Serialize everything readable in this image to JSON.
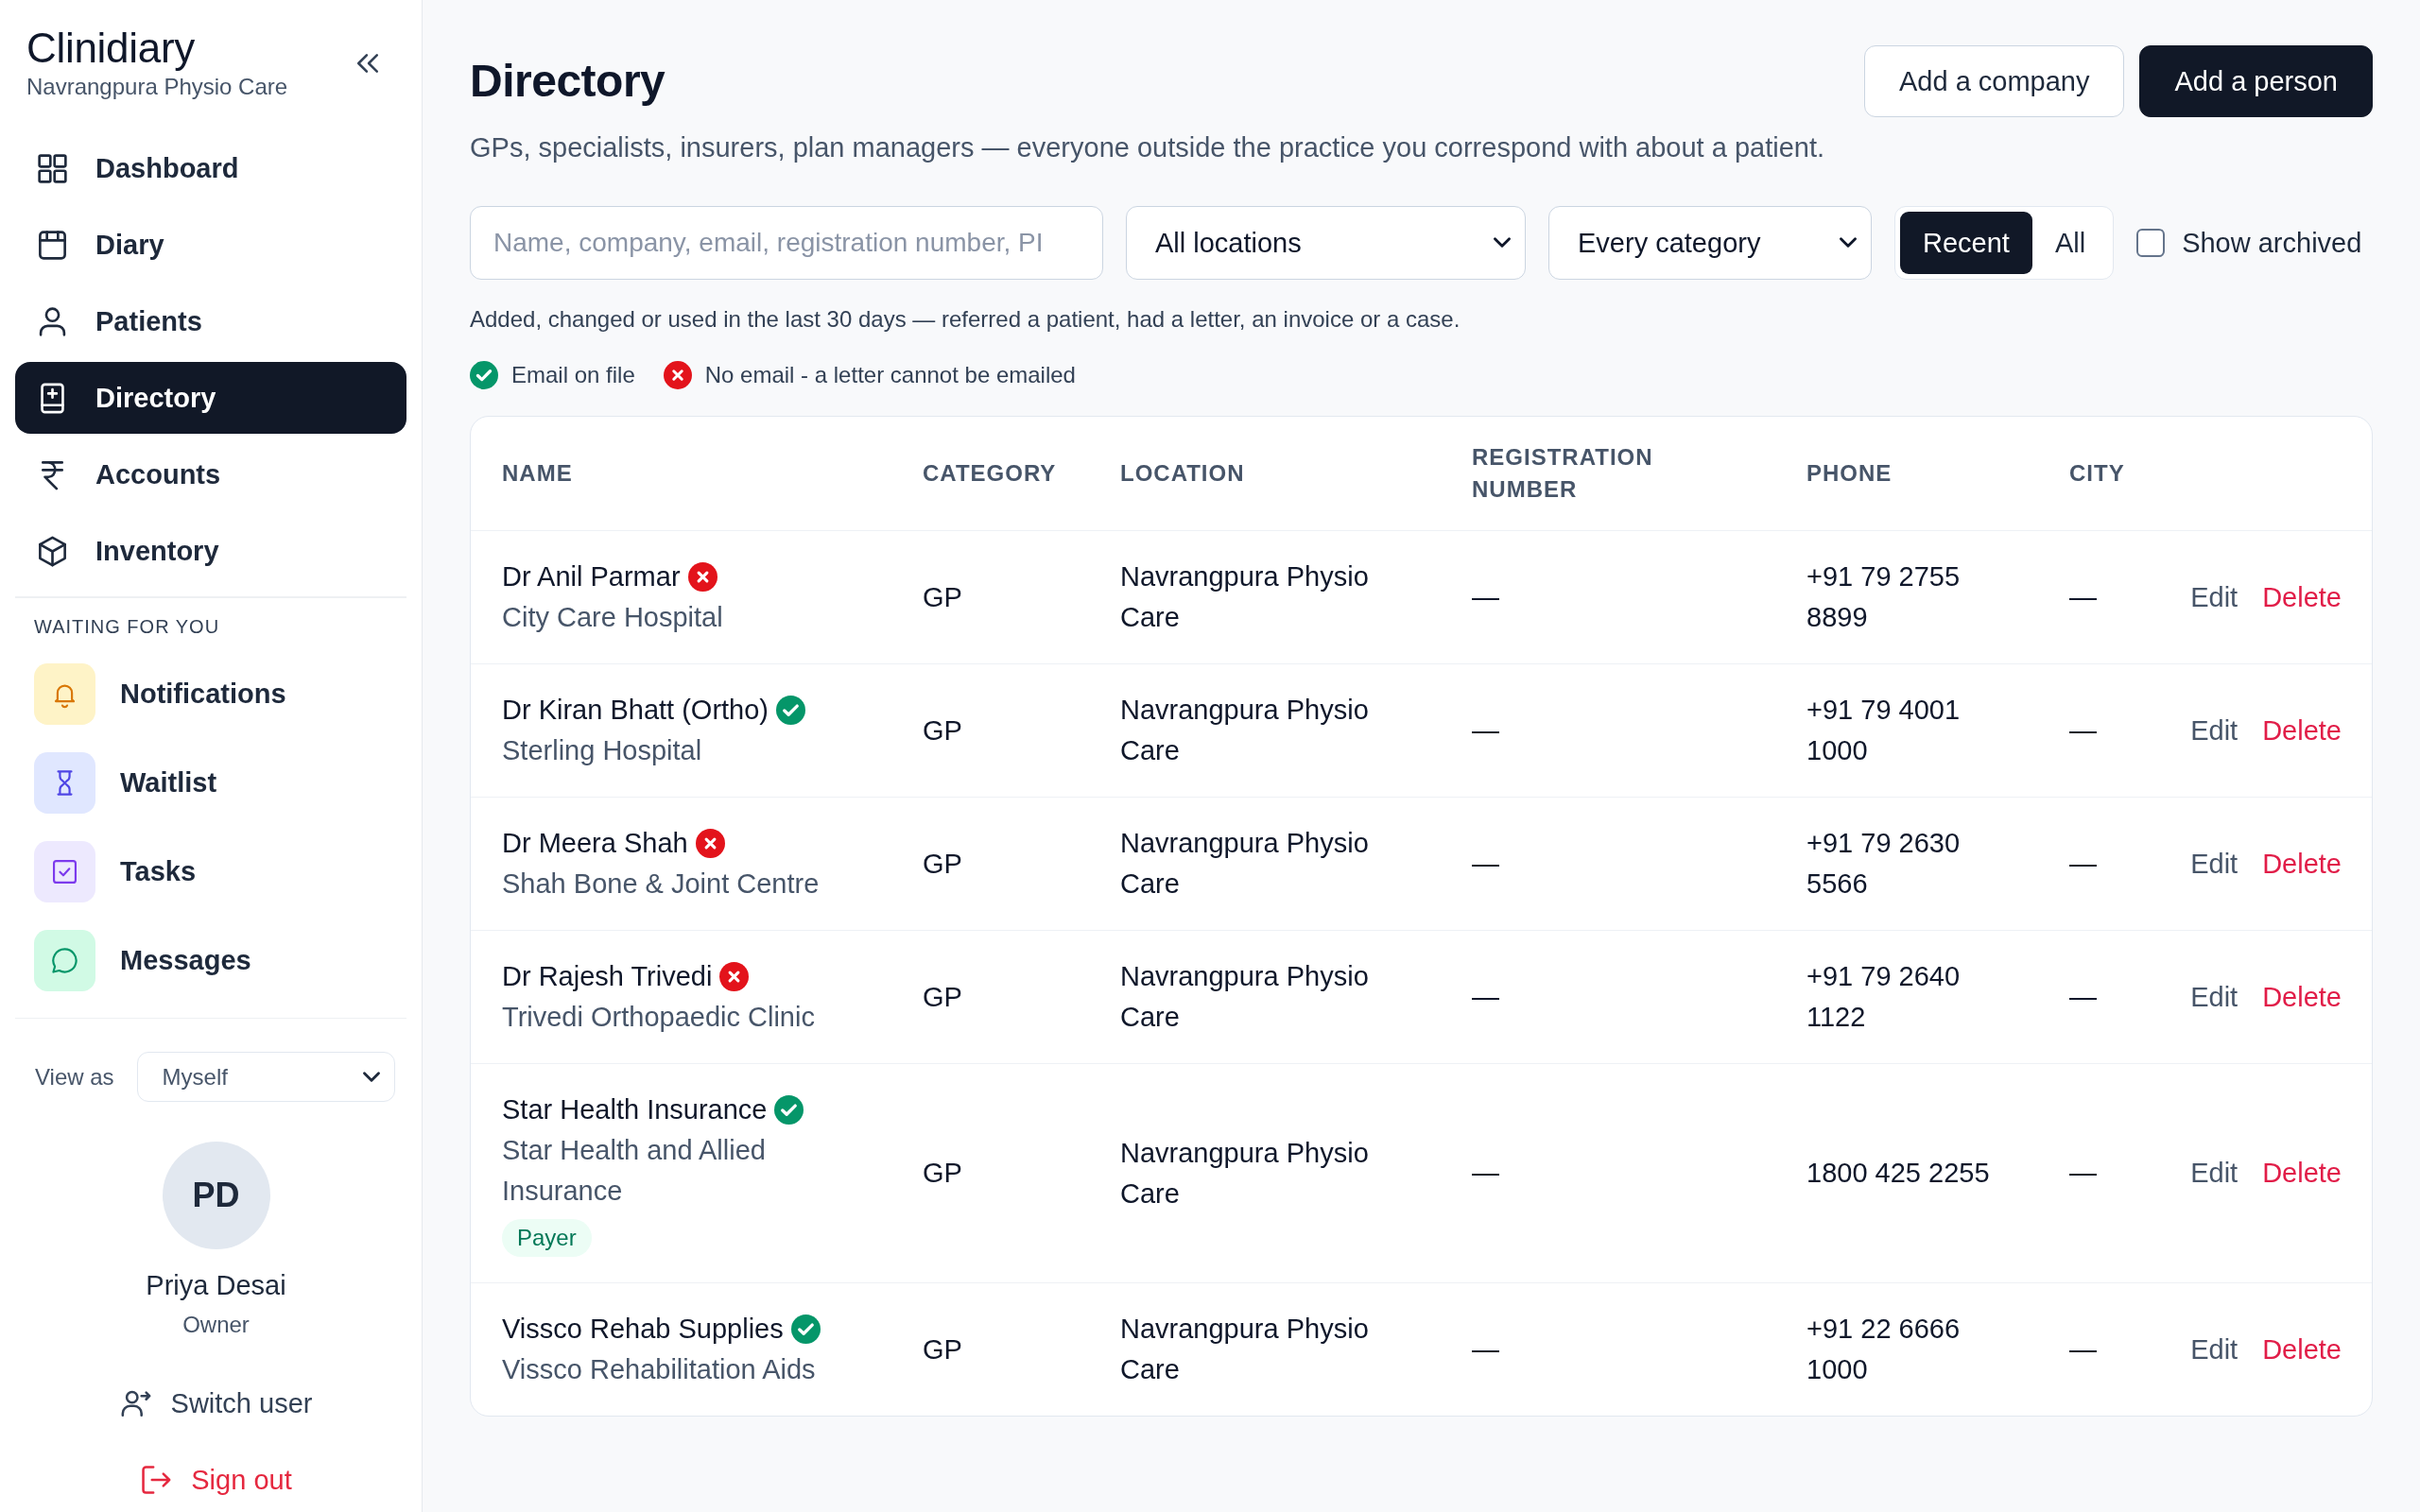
{
  "sidebar": {
    "brand": {
      "name": "Clinidiary",
      "practice": "Navrangpura Physio Care"
    },
    "nav": [
      {
        "label": "Dashboard",
        "selected": false
      },
      {
        "label": "Diary",
        "selected": false
      },
      {
        "label": "Patients",
        "selected": false
      },
      {
        "label": "Directory",
        "selected": true
      },
      {
        "label": "Accounts",
        "selected": false
      },
      {
        "label": "Inventory",
        "selected": false
      }
    ],
    "waiting": {
      "heading": "WAITING FOR YOU",
      "items": [
        {
          "label": "Notifications"
        },
        {
          "label": "Waitlist"
        },
        {
          "label": "Tasks"
        },
        {
          "label": "Messages"
        }
      ]
    },
    "view_as": {
      "label": "View as",
      "value": "Myself"
    },
    "user": {
      "initials": "PD",
      "name": "Priya Desai",
      "role": "Owner"
    },
    "actions": [
      {
        "label": "Switch user",
        "kind": "switch"
      },
      {
        "label": "Sign out",
        "kind": "signout"
      }
    ]
  },
  "page": {
    "title": "Directory",
    "description": "GPs, specialists, insurers, plan managers — everyone outside the practice you correspond with about a patient.",
    "buttons": [
      {
        "label": "Add a company",
        "kind": "secondary"
      },
      {
        "label": "Add a person",
        "kind": "primary"
      }
    ]
  },
  "filters": {
    "search": {
      "placeholder": "Name, company, email, registration number, PI"
    },
    "location": {
      "value": "All locations"
    },
    "category": {
      "value": "Every category"
    },
    "scope": [
      {
        "label": "Recent",
        "selected": true
      },
      {
        "label": "All",
        "selected": false
      }
    ],
    "show_archived": {
      "label": "Show archived",
      "checked": false
    },
    "hint": "Added, changed or used in the last 30 days — referred a patient, had a letter, an invoice or a case."
  },
  "legend": [
    {
      "label": "Email on file",
      "has_email": true
    },
    {
      "label": "No email - a letter cannot be emailed",
      "has_email": false
    }
  ],
  "table": {
    "columns": [
      "NAME",
      "CATEGORY",
      "LOCATION",
      "REGISTRATION NUMBER",
      "PHONE",
      "CITY"
    ],
    "rows": [
      {
        "name": "Dr Anil Parmar",
        "has_email": false,
        "organisation": "City Care Hospital",
        "category": "GP",
        "location": "Navrangpura Physio Care",
        "registration_number": "—",
        "phone": "+91 79 2755 8899",
        "city": "—",
        "actions": [
          {
            "label": "Edit",
            "kind": "edit"
          },
          {
            "label": "Delete",
            "kind": "delete"
          }
        ]
      },
      {
        "name": "Dr Kiran Bhatt (Ortho)",
        "has_email": true,
        "organisation": "Sterling Hospital",
        "category": "GP",
        "location": "Navrangpura Physio Care",
        "registration_number": "—",
        "phone": "+91 79 4001 1000",
        "city": "—",
        "actions": [
          {
            "label": "Edit",
            "kind": "edit"
          },
          {
            "label": "Delete",
            "kind": "delete"
          }
        ]
      },
      {
        "name": "Dr Meera Shah",
        "has_email": false,
        "organisation": "Shah Bone & Joint Centre",
        "category": "GP",
        "location": "Navrangpura Physio Care",
        "registration_number": "—",
        "phone": "+91 79 2630 5566",
        "city": "—",
        "actions": [
          {
            "label": "Edit",
            "kind": "edit"
          },
          {
            "label": "Delete",
            "kind": "delete"
          }
        ]
      },
      {
        "name": "Dr Rajesh Trivedi",
        "has_email": false,
        "organisation": "Trivedi Orthopaedic Clinic",
        "category": "GP",
        "location": "Navrangpura Physio Care",
        "registration_number": "—",
        "phone": "+91 79 2640 1122",
        "city": "—",
        "actions": [
          {
            "label": "Edit",
            "kind": "edit"
          },
          {
            "label": "Delete",
            "kind": "delete"
          }
        ]
      },
      {
        "name": "Star Health Insurance",
        "has_email": true,
        "organisation": "Star Health and Allied Insurance",
        "tag": "Payer",
        "category": "GP",
        "location": "Navrangpura Physio Care",
        "registration_number": "—",
        "phone": "1800 425 2255",
        "city": "—",
        "actions": [
          {
            "label": "Edit",
            "kind": "edit"
          },
          {
            "label": "Delete",
            "kind": "delete"
          }
        ]
      },
      {
        "name": "Vissco Rehab Supplies",
        "has_email": true,
        "organisation": "Vissco Rehabilitation Aids",
        "category": "GP",
        "location": "Navrangpura Physio Care",
        "registration_number": "—",
        "phone": "+91 22 6666 1000",
        "city": "—",
        "actions": [
          {
            "label": "Edit",
            "kind": "edit"
          },
          {
            "label": "Delete",
            "kind": "delete"
          }
        ]
      }
    ]
  }
}
